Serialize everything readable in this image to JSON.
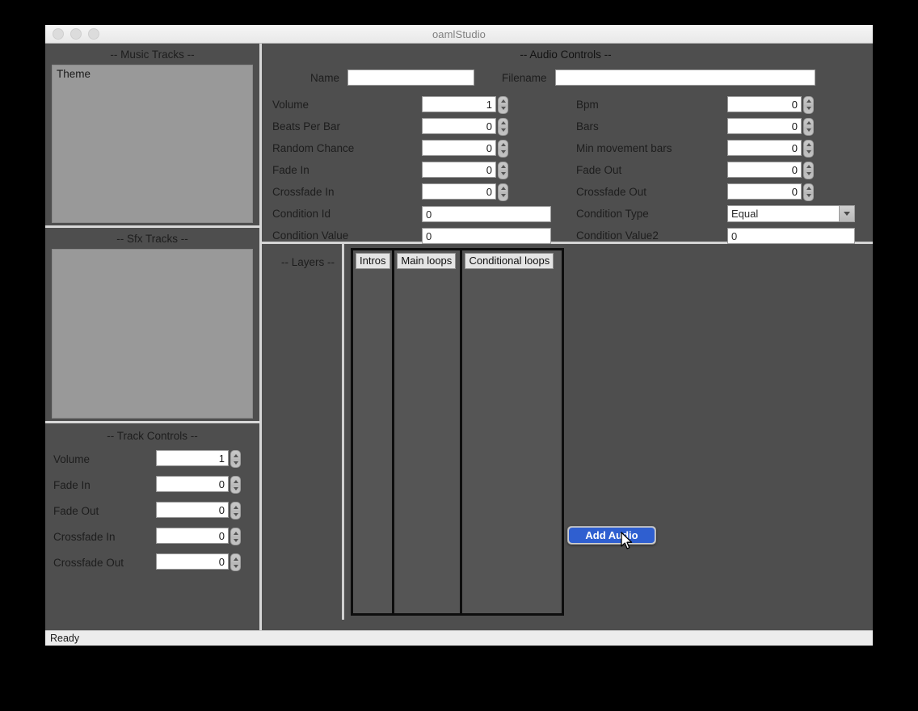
{
  "window": {
    "title": "oamlStudio",
    "traffic_lights": [
      "close",
      "minimize",
      "maximize"
    ]
  },
  "music_tracks": {
    "heading": "-- Music Tracks --",
    "items": [
      {
        "label": "Theme"
      }
    ]
  },
  "sfx_tracks": {
    "heading": "-- Sfx Tracks --",
    "items": []
  },
  "track_controls": {
    "heading": "-- Track Controls --",
    "rows": [
      {
        "label": "Volume",
        "value": "1"
      },
      {
        "label": "Fade In",
        "value": "0"
      },
      {
        "label": "Fade Out",
        "value": "0"
      },
      {
        "label": "Crossfade In",
        "value": "0"
      },
      {
        "label": "Crossfade Out",
        "value": "0"
      }
    ]
  },
  "audio_controls": {
    "heading": "-- Audio Controls --",
    "name": {
      "label": "Name",
      "value": "",
      "placeholder": ""
    },
    "filename": {
      "label": "Filename",
      "value": "",
      "placeholder": ""
    },
    "left_rows": [
      {
        "label": "Volume",
        "value": "1",
        "type": "spin"
      },
      {
        "label": "Beats Per Bar",
        "value": "0",
        "type": "spin"
      },
      {
        "label": "Random Chance",
        "value": "0",
        "type": "spin"
      },
      {
        "label": "Fade In",
        "value": "0",
        "type": "spin"
      },
      {
        "label": "Crossfade In",
        "value": "0",
        "type": "spin"
      },
      {
        "label": "Condition Id",
        "value": "0",
        "type": "text"
      },
      {
        "label": "Condition Value",
        "value": "0",
        "type": "text"
      }
    ],
    "right_rows": [
      {
        "label": "Bpm",
        "value": "0",
        "type": "spin"
      },
      {
        "label": "Bars",
        "value": "0",
        "type": "spin"
      },
      {
        "label": "Min movement bars",
        "value": "0",
        "type": "spin"
      },
      {
        "label": "Fade Out",
        "value": "0",
        "type": "spin"
      },
      {
        "label": "Crossfade Out",
        "value": "0",
        "type": "spin"
      },
      {
        "label": "Condition Type",
        "value": "Equal",
        "type": "dropdown",
        "options": [
          "Equal"
        ]
      },
      {
        "label": "Condition Value2",
        "value": "0",
        "type": "text"
      }
    ]
  },
  "layers": {
    "heading": "-- Layers --",
    "columns": [
      {
        "label": "Intros",
        "items": []
      },
      {
        "label": "Main loops",
        "items": []
      },
      {
        "label": "Conditional loops",
        "items": []
      }
    ]
  },
  "context_menu": {
    "items": [
      {
        "label": "Add Audio",
        "selected": true
      }
    ],
    "highlight_color": "#2f5fd0"
  },
  "statusbar": {
    "text": "Ready"
  }
}
